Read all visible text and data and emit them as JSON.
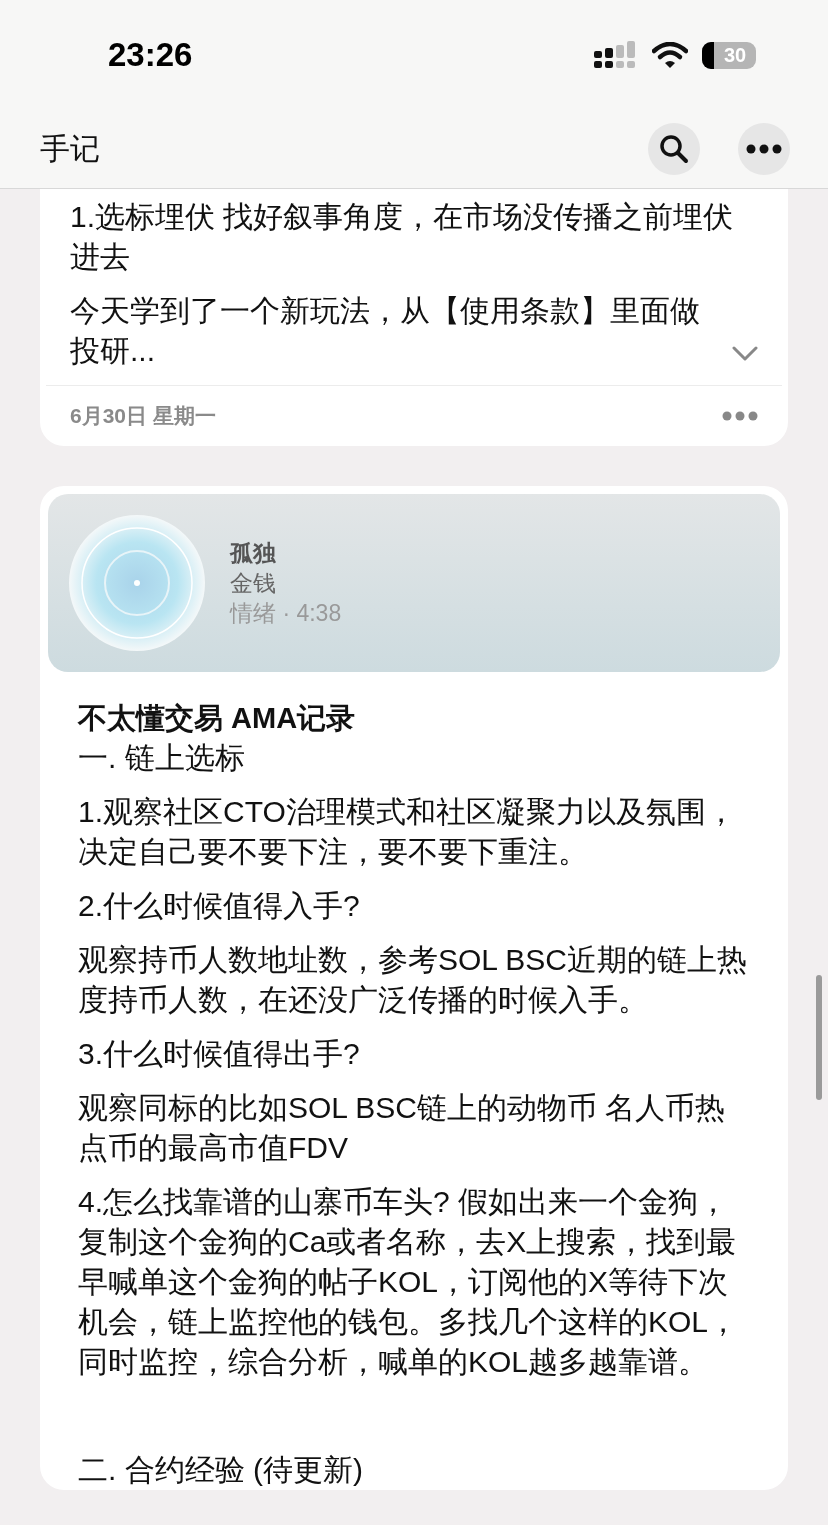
{
  "status_bar": {
    "time": "23:26",
    "battery": "30"
  },
  "header": {
    "title": "手记"
  },
  "notes": [
    {
      "kind": "text",
      "paragraphs": [
        "1.选标埋伏 找好叙事角度，在市场没传播之前埋伏进去",
        "今天学到了一个新玩法，从【使用条款】里面做投研..."
      ],
      "expanded": false,
      "date": "6月30日 星期一"
    },
    {
      "kind": "music",
      "track": {
        "title": "孤独",
        "artist": "金钱",
        "meta": "情绪 · 4:38"
      },
      "heading": "不太懂交易 AMA记录",
      "paragraphs": [
        "一. 链上选标",
        "1.观察社区CTO治理模式和社区凝聚力以及氛围，决定自己要不要下注，要不要下重注。",
        "2.什么时候值得入手?",
        "观察持币人数地址数，参考SOL BSC近期的链上热度持币人数，在还没广泛传播的时候入手。",
        "3.什么时候值得出手?",
        "观察同标的比如SOL BSC链上的动物币 名人币热点币的最高市值FDV",
        "4.怎么找靠谱的山寨币车头? 假如出来一个金狗，复制这个金狗的Ca或者名称，去X上搜索，找到最早喊单这个金狗的帖子KOL，订阅他的X等待下次机会，链上监控他的钱包。多找几个这样的KOL，同时监控，综合分析，喊单的KOL越多越靠谱。"
      ],
      "next_section": "二. 合约经验 (待更新)"
    }
  ]
}
